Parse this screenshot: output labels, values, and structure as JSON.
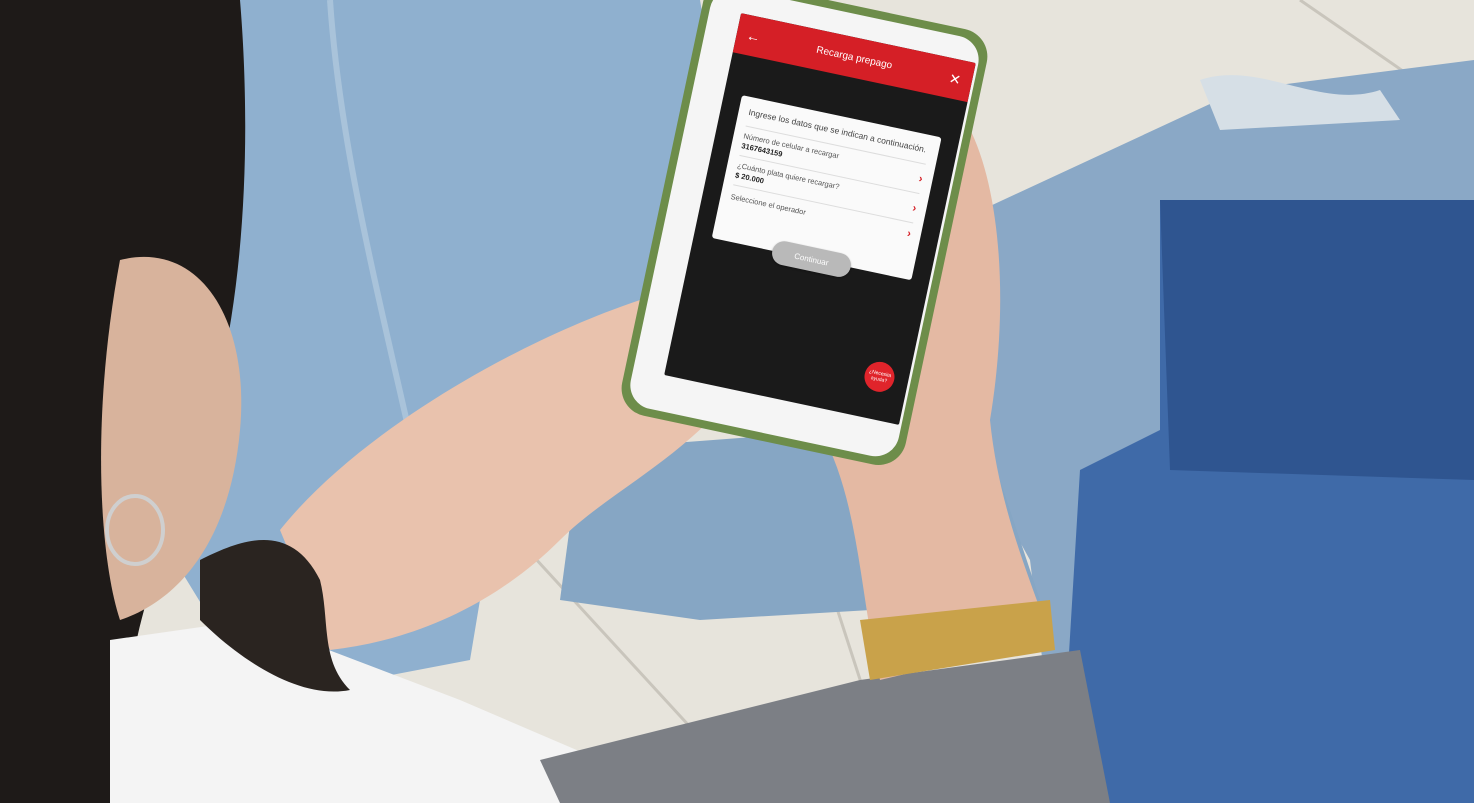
{
  "app": {
    "title": "Recarga prepago",
    "back_icon": "arrow-left-icon",
    "close_icon": "close-icon",
    "accent_color": "#d51f26"
  },
  "form": {
    "intro": "Ingrese los datos que se indican a continuación.",
    "fields": [
      {
        "label": "Número de celular a recargar",
        "value": "3167643159"
      },
      {
        "label": "¿Cuánto plata quiere recargar?",
        "value": "$ 20.000"
      },
      {
        "label": "Seleccione el operador",
        "value": ""
      }
    ],
    "continue_label": "Continuar"
  },
  "help": {
    "label": "¿Necesita ayuda?"
  }
}
